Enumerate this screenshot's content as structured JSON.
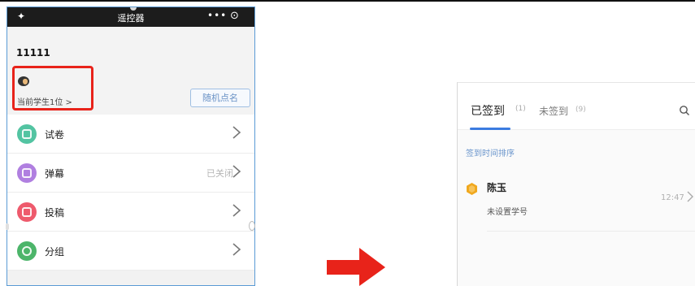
{
  "left_screen": {
    "titlebar": {
      "title": "遥控器",
      "left_icon": "settings-icon",
      "dots": "•••",
      "target_icon": "target-icon"
    },
    "class_name": "11111",
    "student_count": "当前学生1位 >",
    "random_button": "随机点名",
    "menu": [
      {
        "label": "试卷",
        "value": "",
        "icon": "document-icon",
        "color": "#53c4a2"
      },
      {
        "label": "弹幕",
        "value": "已关闭",
        "icon": "bullet-comment-icon",
        "color": "#b07fe0"
      },
      {
        "label": "投稿",
        "value": "",
        "icon": "submit-icon",
        "color": "#ee5a6c"
      },
      {
        "label": "分组",
        "value": "",
        "icon": "group-icon",
        "color": "#4cb56a"
      }
    ]
  },
  "arrow": {
    "color": "#e8231a",
    "icon": "right-arrow-icon"
  },
  "right_screen": {
    "tabs": [
      {
        "label": "已签到",
        "count": "(1)",
        "active": true
      },
      {
        "label": "未签到",
        "count": "(9)",
        "active": false
      }
    ],
    "search_icon": "search-icon",
    "sort_label": "签到时间排序",
    "student": {
      "name": "陈玉",
      "sub": "未设置学号",
      "time": "12:47"
    }
  },
  "colors": {
    "highlight": "#e8231a",
    "accent": "#3b7be0",
    "titlebar": "#1c1c1c"
  }
}
